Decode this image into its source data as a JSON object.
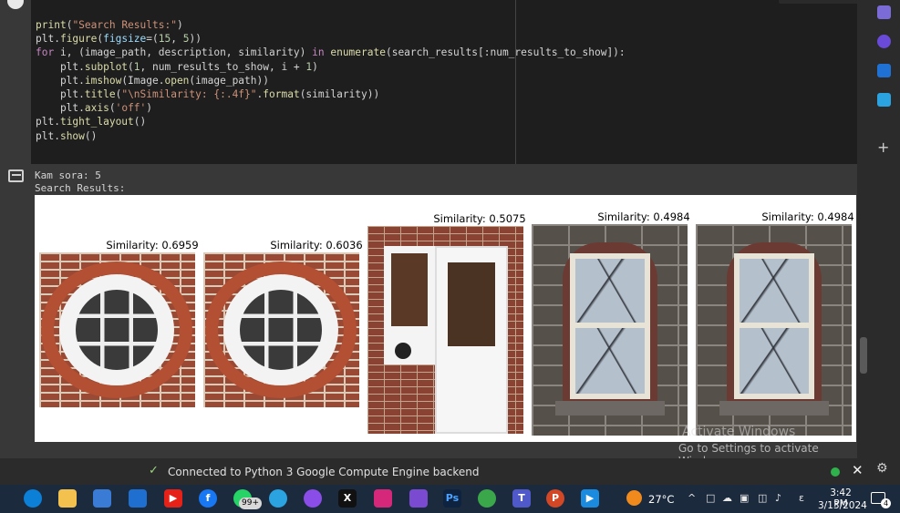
{
  "code_cell": {
    "lines": [
      {
        "parts": [
          {
            "t": "print",
            "c": "f"
          },
          {
            "t": "(",
            "c": "p"
          },
          {
            "t": "\"Search Results:\"",
            "c": "s"
          },
          {
            "t": ")",
            "c": "p"
          }
        ]
      },
      {
        "parts": [
          {
            "t": "plt.",
            "c": "p"
          },
          {
            "t": "figure",
            "c": "f"
          },
          {
            "t": "(",
            "c": "p"
          },
          {
            "t": "figsize",
            "c": "v"
          },
          {
            "t": "=(",
            "c": "p"
          },
          {
            "t": "15",
            "c": "n"
          },
          {
            "t": ", ",
            "c": "p"
          },
          {
            "t": "5",
            "c": "n"
          },
          {
            "t": "))",
            "c": "p"
          }
        ]
      },
      {
        "parts": [
          {
            "t": "for",
            "c": "k"
          },
          {
            "t": " i, (image_path, description, similarity) ",
            "c": "p"
          },
          {
            "t": "in",
            "c": "k"
          },
          {
            "t": " ",
            "c": "p"
          },
          {
            "t": "enumerate",
            "c": "f"
          },
          {
            "t": "(search_results[:num_results_to_show]):",
            "c": "p"
          }
        ]
      },
      {
        "parts": [
          {
            "t": "    plt.",
            "c": "p"
          },
          {
            "t": "subplot",
            "c": "f"
          },
          {
            "t": "(",
            "c": "p"
          },
          {
            "t": "1",
            "c": "n"
          },
          {
            "t": ", num_results_to_show, i + ",
            "c": "p"
          },
          {
            "t": "1",
            "c": "n"
          },
          {
            "t": ")",
            "c": "p"
          }
        ]
      },
      {
        "parts": [
          {
            "t": "    plt.",
            "c": "p"
          },
          {
            "t": "imshow",
            "c": "f"
          },
          {
            "t": "(Image.",
            "c": "p"
          },
          {
            "t": "open",
            "c": "f"
          },
          {
            "t": "(image_path))",
            "c": "p"
          }
        ]
      },
      {
        "parts": [
          {
            "t": "    plt.",
            "c": "p"
          },
          {
            "t": "title",
            "c": "f"
          },
          {
            "t": "(",
            "c": "p"
          },
          {
            "t": "\"\\nSimilarity: {:.4f}\"",
            "c": "s"
          },
          {
            "t": ".",
            "c": "p"
          },
          {
            "t": "format",
            "c": "f"
          },
          {
            "t": "(similarity))",
            "c": "p"
          }
        ]
      },
      {
        "parts": [
          {
            "t": "    plt.",
            "c": "p"
          },
          {
            "t": "axis",
            "c": "f"
          },
          {
            "t": "(",
            "c": "p"
          },
          {
            "t": "'off'",
            "c": "s"
          },
          {
            "t": ")",
            "c": "p"
          }
        ]
      },
      {
        "parts": [
          {
            "t": "plt.",
            "c": "p"
          },
          {
            "t": "tight_layout",
            "c": "f"
          },
          {
            "t": "()",
            "c": "p"
          }
        ]
      },
      {
        "parts": [
          {
            "t": "plt.",
            "c": "p"
          },
          {
            "t": "show",
            "c": "f"
          },
          {
            "t": "()",
            "c": "p"
          }
        ]
      }
    ]
  },
  "output": {
    "line1": "Kam sora: 5",
    "line2": "Search Results:"
  },
  "results": [
    {
      "title": "Similarity: 0.6959",
      "image": "round brick window"
    },
    {
      "title": "Similarity: 0.6036",
      "image": "round brick window"
    },
    {
      "title": "Similarity: 0.5075",
      "image": "white door in brick wall"
    },
    {
      "title": "Similarity: 0.4984",
      "image": "sash window in stone wall"
    },
    {
      "title": "Similarity: 0.4984",
      "image": "sash window in stone wall"
    }
  ],
  "watermark": {
    "line1": "Activate Windows",
    "line2": "Go to Settings to activate Windows."
  },
  "status_bar": {
    "message": "Connected to Python 3 Google Compute Engine backend",
    "close_icon": "close-icon"
  },
  "taskbar": {
    "badge": "99+",
    "temperature": "27°C",
    "time": "3:42 PM",
    "date": "3/13/2024",
    "notification_count": "4",
    "apps": [
      "edge",
      "file-explorer",
      "store",
      "mail",
      "youtube",
      "facebook",
      "whatsapp",
      "telegram",
      "messenger",
      "x",
      "instagram",
      "visual-studio",
      "photoshop",
      "chrome",
      "teams",
      "powerpoint",
      "media-player"
    ]
  },
  "colors": {
    "status_ok": "#2fb24b",
    "accent_weather": "#f08a1c"
  }
}
